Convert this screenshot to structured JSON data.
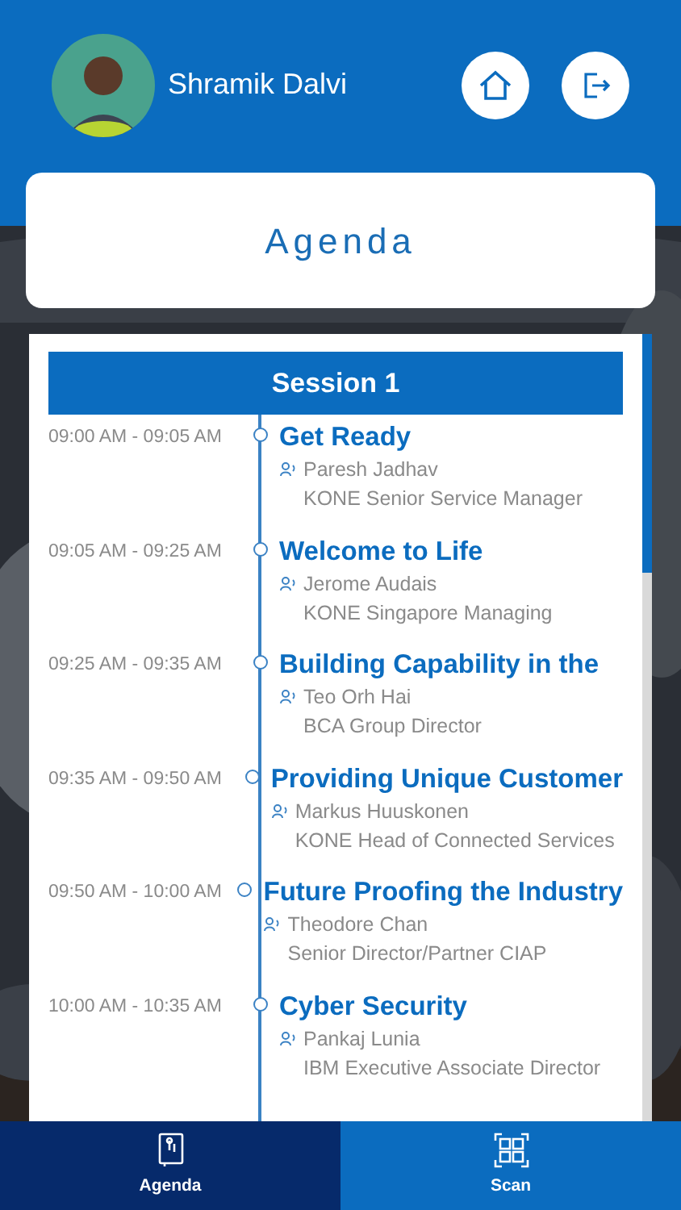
{
  "user": {
    "name": "Shramik Dalvi"
  },
  "page_title": "Agenda",
  "session": {
    "title": "Session 1"
  },
  "agenda": [
    {
      "time": "09:00 AM - 09:05 AM",
      "title": "Get Ready",
      "speaker": "Paresh Jadhav",
      "role": "KONE Senior Service Manager"
    },
    {
      "time": "09:05 AM - 09:25 AM",
      "title": "Welcome to Life",
      "speaker": "Jerome Audais",
      "role": "KONE Singapore Managing"
    },
    {
      "time": "09:25 AM - 09:35 AM",
      "title": "Building Capability in the",
      "speaker": "Teo Orh Hai",
      "role": "BCA Group Director"
    },
    {
      "time": "09:35 AM - 09:50 AM",
      "title": "Providing Unique Customer",
      "speaker": "Markus Huuskonen",
      "role": "KONE Head of Connected Services"
    },
    {
      "time": "09:50 AM - 10:00 AM",
      "title": "Future Proofing the Industry",
      "speaker": "Theodore Chan",
      "role": "Senior Director/Partner CIAP"
    },
    {
      "time": "10:00 AM - 10:35 AM",
      "title": "Cyber Security",
      "speaker": "Pankaj Lunia",
      "role": "IBM Executive Associate Director"
    }
  ],
  "tabs": [
    {
      "kind": "agenda",
      "label": "Agenda",
      "selected": true
    },
    {
      "kind": "scan",
      "label": "Scan",
      "selected": false
    }
  ]
}
